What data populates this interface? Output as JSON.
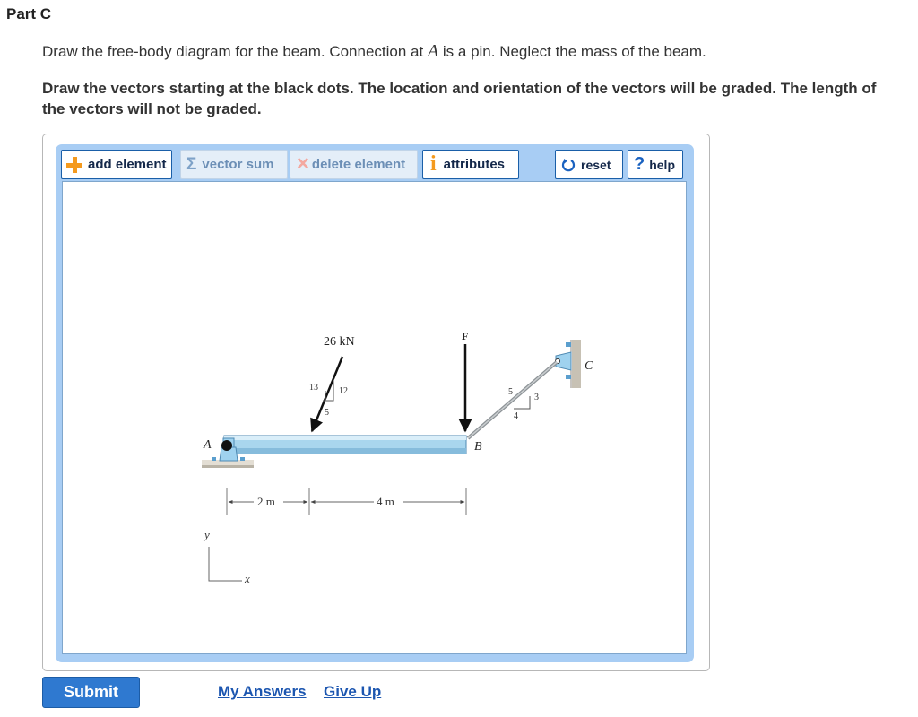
{
  "part": {
    "title": "Part C"
  },
  "instructions": {
    "line1_before": "Draw the free-body diagram for the beam. Connection at ",
    "line1_var": "A",
    "line1_after": " is a pin. Neglect the mass of the beam.",
    "line2": "Draw the vectors starting at the black dots. The location and orientation of the vectors will be graded. The length of the vectors will not be graded."
  },
  "toolbar": {
    "add_element": {
      "label": "add element",
      "icon": "plus-icon"
    },
    "vector_sum": {
      "label": "vector sum",
      "icon": "sigma-icon"
    },
    "delete_element": {
      "label": "delete element",
      "icon": "x-icon"
    },
    "attributes": {
      "label": "attributes",
      "icon": "info-icon"
    },
    "reset": {
      "label": "reset",
      "icon": "reset-icon"
    },
    "help": {
      "label": "help",
      "icon": "question-icon"
    }
  },
  "diagram": {
    "load_label": "26 kN",
    "load_slope": {
      "hyp": "13",
      "vert": "12",
      "horiz": "5"
    },
    "force_label": "F",
    "cable_slope": {
      "hyp": "5",
      "vert": "3",
      "horiz": "4"
    },
    "point_a": "A",
    "point_b": "B",
    "point_c": "C",
    "dim_left": "2 m",
    "dim_right": "4 m",
    "axis_y": "y",
    "axis_x": "x"
  },
  "colors": {
    "accent": "#2f79d0",
    "toolbar_frame": "#a8cdf4",
    "beam": "#a9d6ee",
    "link": "#1c56b0"
  },
  "footer": {
    "submit": "Submit",
    "my_answers": "My Answers",
    "give_up": "Give Up"
  }
}
